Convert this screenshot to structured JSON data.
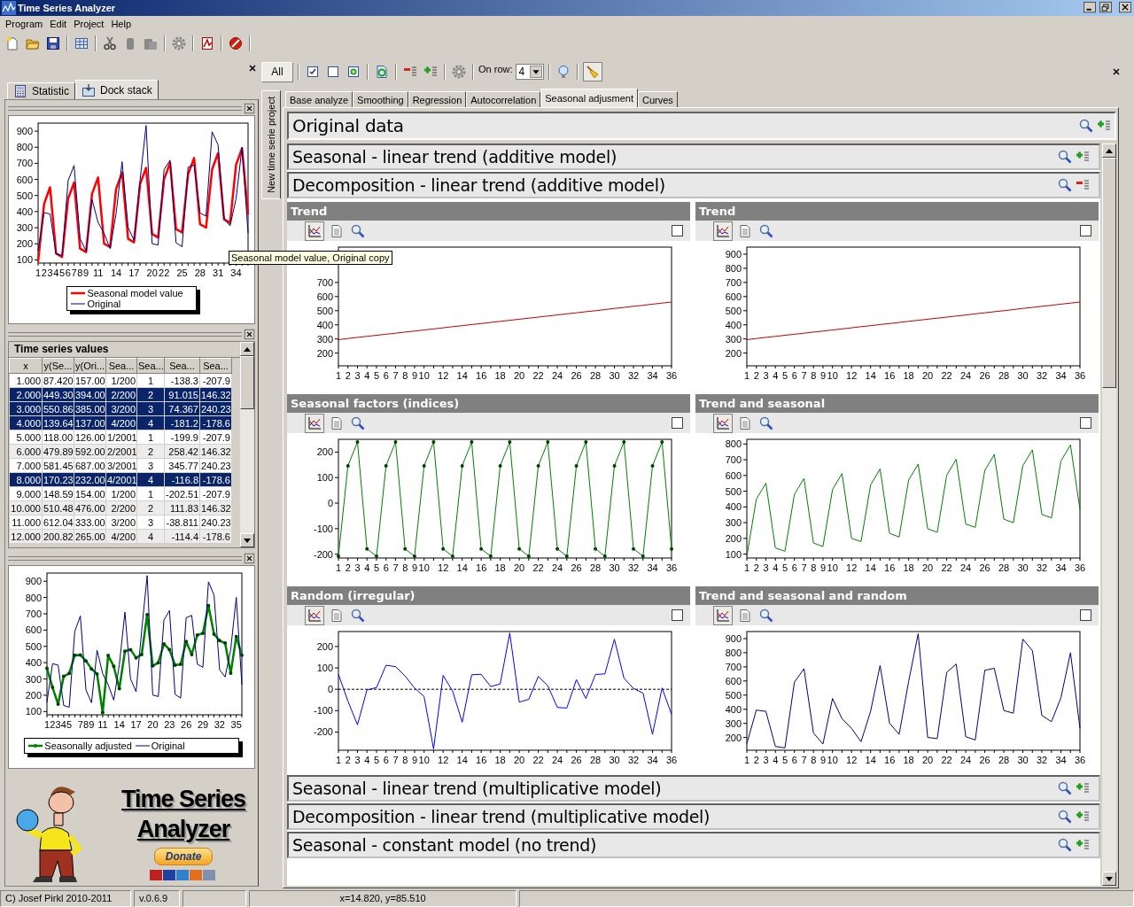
{
  "window": {
    "title": "Time Series Analyzer"
  },
  "menu": [
    "Program",
    "Edit",
    "Project",
    "Help"
  ],
  "left_tabs": [
    {
      "label": "Statistic",
      "selected": false
    },
    {
      "label": "Dock stack",
      "selected": true
    }
  ],
  "top_chart": {
    "chart_data": {
      "type": "line",
      "x": [
        1,
        2,
        3,
        4,
        5,
        6,
        7,
        8,
        9,
        10,
        11,
        12,
        13,
        14,
        15,
        16,
        17,
        18,
        19,
        20,
        21,
        22,
        23,
        24,
        25,
        26,
        27,
        28,
        29,
        30,
        31,
        32,
        33,
        34,
        35,
        36
      ],
      "xlim": [
        1,
        36
      ],
      "ylim": [
        80,
        950
      ],
      "xticks": [
        1,
        2,
        3,
        4,
        5,
        6,
        7,
        8,
        9,
        11,
        14,
        17,
        20,
        22,
        25,
        28,
        31,
        34
      ],
      "yticks": [
        100,
        200,
        300,
        400,
        500,
        600,
        700,
        800,
        900
      ],
      "series": [
        {
          "name": "Seasonal model value",
          "color": "#ff0000",
          "values": [
            87,
            449,
            551,
            140,
            118,
            480,
            581,
            170,
            148,
            510,
            612,
            200,
            179,
            540,
            642,
            231,
            209,
            571,
            672,
            261,
            239,
            601,
            703,
            291,
            270,
            632,
            733,
            322,
            300,
            662,
            763,
            352,
            330,
            692,
            794,
            383
          ]
        },
        {
          "name": "Original",
          "color": "#000080",
          "values": [
            157,
            394,
            385,
            137,
            126,
            592,
            687,
            232,
            154,
            476,
            333,
            265,
            170,
            386,
            710,
            301,
            222,
            596,
            935,
            201,
            192,
            661,
            720,
            206,
            182,
            676,
            690,
            391,
            372,
            896,
            815,
            356,
            312,
            481,
            800,
            266
          ]
        }
      ]
    }
  },
  "tooltip": "Seasonal model value, Original copy",
  "values_table": {
    "title": "Time series values",
    "columns": [
      "x",
      "y(Se...",
      "y(Ori...",
      "Sea...",
      "Sea...",
      "Sea...",
      "Sea..."
    ],
    "rows": [
      {
        "cells": [
          "1.000",
          "87.420",
          "157.00",
          "1/200",
          "1",
          "-138.3",
          "-207.9"
        ],
        "selected": false
      },
      {
        "cells": [
          "2.000",
          "449.30",
          "394.00",
          "2/200",
          "2",
          "91.015",
          "146.32"
        ],
        "selected": true
      },
      {
        "cells": [
          "3.000",
          "550.86",
          "385.00",
          "3/200",
          "3",
          "74.367",
          "240.23"
        ],
        "selected": true
      },
      {
        "cells": [
          "4.000",
          "139.64",
          "137.00",
          "4/200",
          "4",
          "-181.2",
          "-178.6"
        ],
        "selected": true
      },
      {
        "cells": [
          "5.000",
          "118.00",
          "126.00",
          "1/2001",
          "1",
          "-199.9",
          "-207.9"
        ],
        "selected": false
      },
      {
        "cells": [
          "6.000",
          "479.89",
          "592.00",
          "2/2001",
          "2",
          "258.42",
          "146.32"
        ],
        "selected": false
      },
      {
        "cells": [
          "7.000",
          "581.45",
          "687.00",
          "3/2001",
          "3",
          "345.77",
          "240.23"
        ],
        "selected": false
      },
      {
        "cells": [
          "8.000",
          "170.23",
          "232.00",
          "4/2001",
          "4",
          "-116.8",
          "-178.6"
        ],
        "selected": true
      },
      {
        "cells": [
          "9.000",
          "148.59",
          "154.00",
          "1/200",
          "1",
          "-202.51",
          "-207.9"
        ],
        "selected": false
      },
      {
        "cells": [
          "10.000",
          "510.48",
          "476.00",
          "2/200",
          "2",
          "111.83",
          "146.32"
        ],
        "selected": false
      },
      {
        "cells": [
          "11.000",
          "612.04",
          "333.00",
          "3/200",
          "3",
          "-38.811",
          "240.23"
        ],
        "selected": false
      },
      {
        "cells": [
          "12.000",
          "200.82",
          "265.00",
          "4/200",
          "4",
          "-114.4",
          "-178.6"
        ],
        "selected": false
      }
    ]
  },
  "bottom_chart": {
    "chart_data": {
      "type": "line",
      "x": [
        1,
        2,
        3,
        4,
        5,
        6,
        7,
        8,
        9,
        10,
        11,
        12,
        13,
        14,
        15,
        16,
        17,
        18,
        19,
        20,
        21,
        22,
        23,
        24,
        25,
        26,
        27,
        28,
        29,
        30,
        31,
        32,
        33,
        34,
        35,
        36
      ],
      "xlim": [
        1,
        36
      ],
      "ylim": [
        80,
        950
      ],
      "xticks": [
        1,
        2,
        3,
        4,
        5,
        7,
        8,
        9,
        11,
        14,
        17,
        20,
        23,
        26,
        29,
        32,
        35
      ],
      "yticks": [
        100,
        200,
        300,
        400,
        500,
        600,
        700,
        800,
        900
      ],
      "series": [
        {
          "name": "Seasonally adjusted",
          "color": "#008000",
          "values": [
            365,
            248,
            145,
            316,
            334,
            446,
            447,
            411,
            362,
            330,
            93,
            444,
            378,
            240,
            470,
            480,
            430,
            450,
            695,
            380,
            400,
            515,
            480,
            385,
            390,
            530,
            450,
            570,
            580,
            750,
            575,
            535,
            520,
            335,
            560,
            445
          ]
        },
        {
          "name": "Original",
          "color": "#000080",
          "values": [
            157,
            394,
            385,
            137,
            126,
            592,
            687,
            232,
            154,
            476,
            333,
            265,
            170,
            386,
            710,
            301,
            222,
            596,
            935,
            201,
            192,
            661,
            720,
            206,
            182,
            676,
            690,
            391,
            372,
            896,
            815,
            356,
            312,
            481,
            800,
            266
          ]
        }
      ]
    }
  },
  "logo": {
    "title_lines": [
      "Time Series",
      "Analyzer"
    ],
    "donate": "Donate"
  },
  "toolbar": {
    "all_button": "All",
    "on_row_label": "On row:",
    "on_row_value": "4"
  },
  "side_tab": "New time serie project",
  "tabs": [
    {
      "label": "Base analyze",
      "selected": false
    },
    {
      "label": "Smoothing",
      "selected": false
    },
    {
      "label": "Regression",
      "selected": false
    },
    {
      "label": "Autocorrelation",
      "selected": false
    },
    {
      "label": "Seasonal adjusment",
      "selected": true
    },
    {
      "label": "Curves",
      "selected": false
    }
  ],
  "pinned_section": {
    "title": "Original data",
    "expanded": false
  },
  "sections": [
    {
      "title": "Seasonal - linear trend (additive model)",
      "expanded": false
    },
    {
      "title": "Decomposition - linear trend (additive model)",
      "expanded": true,
      "panels": [
        {
          "title": "Trend",
          "checked": false,
          "chart_data": {
            "type": "line",
            "x": [
              1,
              2,
              3,
              4,
              5,
              6,
              7,
              8,
              9,
              10,
              11,
              12,
              13,
              14,
              15,
              16,
              17,
              18,
              19,
              20,
              21,
              22,
              23,
              24,
              25,
              26,
              27,
              28,
              29,
              30,
              31,
              32,
              33,
              34,
              35,
              36
            ],
            "xlim": [
              1,
              36
            ],
            "ylim": [
              110,
              950
            ],
            "xticks": [
              1,
              2,
              3,
              4,
              5,
              6,
              7,
              8,
              9,
              10,
              12,
              14,
              16,
              18,
              20,
              22,
              24,
              26,
              28,
              30,
              32,
              34,
              36
            ],
            "yticks": [
              200,
              300,
              400,
              500,
              600,
              700
            ],
            "series": [
              {
                "color": "#c00000",
                "values": [
                  295,
                  303,
                  311,
                  318,
                  326,
                  333,
                  341,
                  349,
                  356,
                  364,
                  371,
                  379,
                  387,
                  394,
                  402,
                  409,
                  417,
                  425,
                  432,
                  440,
                  447,
                  455,
                  462,
                  470,
                  478,
                  485,
                  493,
                  500,
                  508,
                  516,
                  523,
                  531,
                  538,
                  546,
                  554,
                  561
                ]
              }
            ]
          }
        },
        {
          "title": "Trend",
          "checked": false,
          "chart_data": {
            "type": "line",
            "x": [
              1,
              2,
              3,
              4,
              5,
              6,
              7,
              8,
              9,
              10,
              11,
              12,
              13,
              14,
              15,
              16,
              17,
              18,
              19,
              20,
              21,
              22,
              23,
              24,
              25,
              26,
              27,
              28,
              29,
              30,
              31,
              32,
              33,
              34,
              35,
              36
            ],
            "xlim": [
              1,
              36
            ],
            "ylim": [
              110,
              950
            ],
            "xticks": [
              1,
              2,
              3,
              4,
              5,
              6,
              7,
              8,
              9,
              10,
              12,
              14,
              16,
              18,
              20,
              22,
              24,
              26,
              28,
              30,
              32,
              34,
              36
            ],
            "yticks": [
              200,
              300,
              400,
              500,
              600,
              700,
              800,
              900
            ],
            "series": [
              {
                "color": "#c00000",
                "values": [
                  295,
                  303,
                  311,
                  318,
                  326,
                  333,
                  341,
                  349,
                  356,
                  364,
                  371,
                  379,
                  387,
                  394,
                  402,
                  409,
                  417,
                  425,
                  432,
                  440,
                  447,
                  455,
                  462,
                  470,
                  478,
                  485,
                  493,
                  500,
                  508,
                  516,
                  523,
                  531,
                  538,
                  546,
                  554,
                  561
                ]
              }
            ]
          }
        },
        {
          "title": "Seasonal factors (indices)",
          "checked": false,
          "chart_data": {
            "type": "line",
            "x": [
              1,
              2,
              3,
              4,
              5,
              6,
              7,
              8,
              9,
              10,
              11,
              12,
              13,
              14,
              15,
              16,
              17,
              18,
              19,
              20,
              21,
              22,
              23,
              24,
              25,
              26,
              27,
              28,
              29,
              30,
              31,
              32,
              33,
              34,
              35,
              36
            ],
            "xlim": [
              1,
              36
            ],
            "ylim": [
              -215,
              250
            ],
            "xticks": [
              1,
              2,
              3,
              4,
              5,
              6,
              7,
              8,
              9,
              10,
              12,
              14,
              16,
              18,
              20,
              22,
              24,
              26,
              28,
              30,
              32,
              34,
              36
            ],
            "yticks": [
              -200,
              -100,
              0,
              100,
              200
            ],
            "series": [
              {
                "color": "#008000",
                "values": [
                  -208,
                  146,
                  240,
                  -179,
                  -208,
                  146,
                  240,
                  -179,
                  -208,
                  146,
                  240,
                  -179,
                  -208,
                  146,
                  240,
                  -179,
                  -208,
                  146,
                  240,
                  -179,
                  -208,
                  146,
                  240,
                  -179,
                  -208,
                  146,
                  240,
                  -179,
                  -208,
                  146,
                  240,
                  -179,
                  -208,
                  146,
                  240,
                  -179
                ]
              }
            ]
          }
        },
        {
          "title": "Trend and seasonal",
          "checked": false,
          "chart_data": {
            "type": "line",
            "x": [
              1,
              2,
              3,
              4,
              5,
              6,
              7,
              8,
              9,
              10,
              11,
              12,
              13,
              14,
              15,
              16,
              17,
              18,
              19,
              20,
              21,
              22,
              23,
              24,
              25,
              26,
              27,
              28,
              29,
              30,
              31,
              32,
              33,
              34,
              35,
              36
            ],
            "xlim": [
              1,
              36
            ],
            "ylim": [
              75,
              830
            ],
            "xticks": [
              1,
              2,
              3,
              4,
              5,
              6,
              7,
              8,
              9,
              10,
              12,
              14,
              16,
              18,
              20,
              22,
              24,
              26,
              28,
              30,
              32,
              34,
              36
            ],
            "yticks": [
              100,
              200,
              300,
              400,
              500,
              600,
              700,
              800
            ],
            "series": [
              {
                "color": "#008000",
                "values": [
                  87,
                  449,
                  551,
                  140,
                  118,
                  480,
                  581,
                  170,
                  148,
                  510,
                  612,
                  200,
                  179,
                  540,
                  642,
                  231,
                  209,
                  571,
                  672,
                  261,
                  239,
                  601,
                  703,
                  291,
                  270,
                  632,
                  733,
                  322,
                  300,
                  662,
                  763,
                  352,
                  330,
                  692,
                  794,
                  383
                ]
              }
            ]
          }
        },
        {
          "title": "Random (irregular)",
          "checked": false,
          "chart_data": {
            "type": "line",
            "x": [
              1,
              2,
              3,
              4,
              5,
              6,
              7,
              8,
              9,
              10,
              11,
              12,
              13,
              14,
              15,
              16,
              17,
              18,
              19,
              20,
              21,
              22,
              23,
              24,
              25,
              26,
              27,
              28,
              29,
              30,
              31,
              32,
              33,
              34,
              35,
              36
            ],
            "xlim": [
              1,
              36
            ],
            "ylim": [
              -285,
              270
            ],
            "xticks": [
              1,
              2,
              3,
              4,
              5,
              6,
              7,
              8,
              9,
              10,
              12,
              14,
              16,
              18,
              20,
              22,
              24,
              26,
              28,
              30,
              32,
              34,
              36
            ],
            "yticks": [
              -200,
              -100,
              0,
              100,
              200
            ],
            "series": [
              {
                "color": "#0000ff",
                "values": [
                  70,
                  -55,
                  -166,
                  -3,
                  8,
                  112,
                  106,
                  62,
                  6,
                  -34,
                  -279,
                  65,
                  -9,
                  -154,
                  68,
                  70,
                  13,
                  25,
                  263,
                  -60,
                  -47,
                  60,
                  17,
                  -85,
                  -88,
                  45,
                  -43,
                  69,
                  72,
                  234,
                  52,
                  4,
                  -18,
                  -211,
                  6,
                  -117
                ]
              }
            ]
          }
        },
        {
          "title": "Trend and seasonal and random",
          "checked": false,
          "chart_data": {
            "type": "line",
            "x": [
              1,
              2,
              3,
              4,
              5,
              6,
              7,
              8,
              9,
              10,
              11,
              12,
              13,
              14,
              15,
              16,
              17,
              18,
              19,
              20,
              21,
              22,
              23,
              24,
              25,
              26,
              27,
              28,
              29,
              30,
              31,
              32,
              33,
              34,
              35,
              36
            ],
            "xlim": [
              1,
              36
            ],
            "ylim": [
              110,
              950
            ],
            "xticks": [
              1,
              2,
              3,
              4,
              5,
              6,
              7,
              8,
              9,
              10,
              12,
              14,
              16,
              18,
              20,
              22,
              24,
              26,
              28,
              30,
              32,
              34,
              36
            ],
            "yticks": [
              200,
              300,
              400,
              500,
              600,
              700,
              800,
              900
            ],
            "series": [
              {
                "color": "#000080",
                "values": [
                  157,
                  394,
                  385,
                  137,
                  126,
                  592,
                  687,
                  232,
                  154,
                  476,
                  333,
                  265,
                  170,
                  386,
                  710,
                  301,
                  222,
                  596,
                  935,
                  201,
                  192,
                  661,
                  720,
                  206,
                  182,
                  676,
                  690,
                  391,
                  372,
                  896,
                  815,
                  356,
                  312,
                  481,
                  800,
                  266
                ]
              }
            ]
          }
        }
      ]
    },
    {
      "title": "Seasonal - linear trend (multiplicative model)",
      "expanded": false
    },
    {
      "title": "Decomposition - linear trend (multiplicative model)",
      "expanded": false
    },
    {
      "title": "Seasonal - constant model (no trend)",
      "expanded": false
    }
  ],
  "status_bar": [
    "C) Josef Pirkl 2010-2011",
    "v.0.6.9",
    "x=14.820, y=85.510"
  ]
}
